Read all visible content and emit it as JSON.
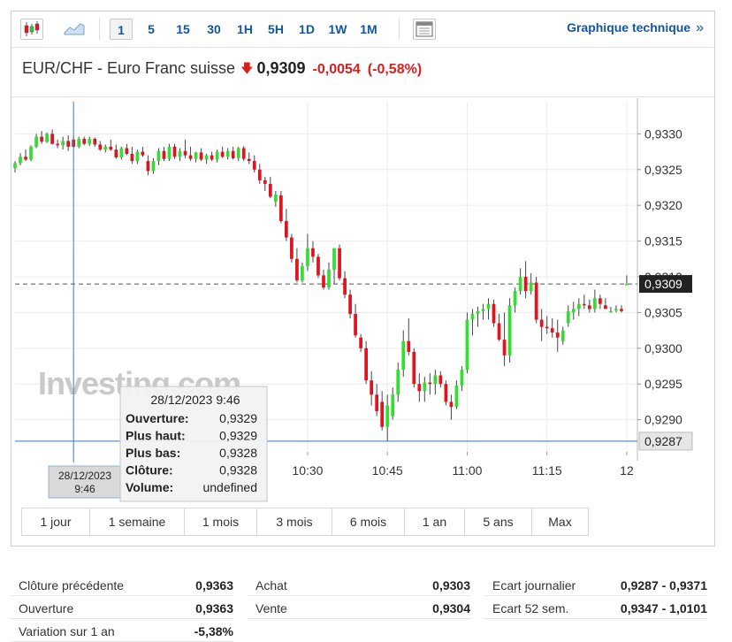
{
  "toolbar": {
    "icons": [
      "candlestick-chart-icon",
      "area-chart-icon",
      "fullscreen-chart-icon"
    ],
    "intervals": [
      "1",
      "5",
      "15",
      "30",
      "1H",
      "5H",
      "1D",
      "1W",
      "1M"
    ],
    "active_interval": "1",
    "tech_link": "Graphique technique",
    "tech_link_icon": "»"
  },
  "quote": {
    "pair": "EUR/CHF - Euro Franc suisse",
    "direction_icon": "down-arrow-icon",
    "price": "0,9309",
    "change": "-0,0054",
    "change_pct": "(-0,58%)"
  },
  "colors": {
    "up": "#33dd33",
    "down": "#e0141e",
    "negative_text": "#d91e1e",
    "link": "#1256a0",
    "crosshair": "#3a78c2"
  },
  "chart_data": {
    "type": "candlestick",
    "x_tick_labels": [
      "10:30",
      "10:45",
      "11:00",
      "11:15",
      "12"
    ],
    "x_ticks": [
      "10:30",
      "10:45",
      "11:00",
      "11:15",
      "11:30"
    ],
    "y_tick_labels": [
      "0,9330",
      "0,9325",
      "0,9320",
      "0,9315",
      "0,9310",
      "0,9305",
      "0,9300",
      "0,9295",
      "0,9290"
    ],
    "y_ticks": [
      0.933,
      0.9325,
      0.932,
      0.9315,
      0.931,
      0.9305,
      0.93,
      0.9295,
      0.929
    ],
    "ylim": [
      0.92855,
      0.93345
    ],
    "x_start": "09:35",
    "x_end": "11:32",
    "current_price": 0.9309,
    "current_price_label": "0,9309",
    "crosshair_price": 0.9287,
    "crosshair_price_label": "0,9287",
    "crosshair_time": "09:46",
    "crosshair_time_label": [
      "28/12/2023",
      "9:46"
    ],
    "watermark": "Investing.com",
    "candles": [
      [
        "09:35",
        0.93252,
        0.93262,
        0.93246,
        0.93259
      ],
      [
        "09:36",
        0.93259,
        0.93273,
        0.93256,
        0.93268
      ],
      [
        "09:37",
        0.93268,
        0.93278,
        0.93262,
        0.93264
      ],
      [
        "09:38",
        0.93264,
        0.93284,
        0.93262,
        0.93282
      ],
      [
        "09:39",
        0.93282,
        0.933,
        0.9328,
        0.93296
      ],
      [
        "09:40",
        0.93296,
        0.93304,
        0.93286,
        0.93289
      ],
      [
        "09:41",
        0.93289,
        0.93302,
        0.93287,
        0.933
      ],
      [
        "09:42",
        0.933,
        0.93306,
        0.93285,
        0.93286
      ],
      [
        "09:43",
        0.93286,
        0.93292,
        0.9328,
        0.93284
      ],
      [
        "09:44",
        0.93284,
        0.93296,
        0.93278,
        0.9329
      ],
      [
        "09:45",
        0.9329,
        0.93298,
        0.93276,
        0.93282
      ],
      [
        "09:46",
        0.93292,
        0.93296,
        0.9328,
        0.93282
      ],
      [
        "09:47",
        0.93282,
        0.93296,
        0.9328,
        0.93293
      ],
      [
        "09:48",
        0.93293,
        0.93296,
        0.93284,
        0.93286
      ],
      [
        "09:49",
        0.93286,
        0.93296,
        0.93283,
        0.93293
      ],
      [
        "09:50",
        0.93293,
        0.93295,
        0.93282,
        0.93285
      ],
      [
        "09:51",
        0.93285,
        0.9329,
        0.93276,
        0.93278
      ],
      [
        "09:52",
        0.93278,
        0.93285,
        0.93274,
        0.93282
      ],
      [
        "09:53",
        0.93282,
        0.93292,
        0.93276,
        0.93278
      ],
      [
        "09:54",
        0.93278,
        0.93285,
        0.93265,
        0.93267
      ],
      [
        "09:55",
        0.93267,
        0.93282,
        0.93264,
        0.9328
      ],
      [
        "09:56",
        0.9328,
        0.93286,
        0.9327,
        0.93272
      ],
      [
        "09:57",
        0.93272,
        0.93282,
        0.93258,
        0.93262
      ],
      [
        "09:58",
        0.93262,
        0.93278,
        0.93258,
        0.93275
      ],
      [
        "09:59",
        0.93275,
        0.93282,
        0.93268,
        0.9327
      ],
      [
        "10:00",
        0.93262,
        0.9327,
        0.93242,
        0.93248
      ],
      [
        "10:01",
        0.93248,
        0.93266,
        0.93244,
        0.93262
      ],
      [
        "10:02",
        0.93262,
        0.9328,
        0.93256,
        0.93276
      ],
      [
        "10:03",
        0.93276,
        0.93282,
        0.93262,
        0.93265
      ],
      [
        "10:04",
        0.93265,
        0.93286,
        0.93262,
        0.93282
      ],
      [
        "10:05",
        0.93282,
        0.93286,
        0.93265,
        0.93268
      ],
      [
        "10:06",
        0.93268,
        0.9328,
        0.93262,
        0.93276
      ],
      [
        "10:07",
        0.93276,
        0.93292,
        0.93266,
        0.9327
      ],
      [
        "10:08",
        0.9327,
        0.93282,
        0.93262,
        0.93265
      ],
      [
        "10:09",
        0.93265,
        0.93275,
        0.9326,
        0.93274
      ],
      [
        "10:10",
        0.93274,
        0.9328,
        0.93262,
        0.93264
      ],
      [
        "10:11",
        0.93264,
        0.93272,
        0.93258,
        0.9327
      ],
      [
        "10:12",
        0.9327,
        0.93275,
        0.93262,
        0.93264
      ],
      [
        "10:13",
        0.93264,
        0.93278,
        0.9326,
        0.93275
      ],
      [
        "10:14",
        0.93275,
        0.93282,
        0.93266,
        0.93268
      ],
      [
        "10:15",
        0.93268,
        0.9328,
        0.93264,
        0.93276
      ],
      [
        "10:16",
        0.93276,
        0.93282,
        0.93264,
        0.93266
      ],
      [
        "10:17",
        0.93266,
        0.93282,
        0.93262,
        0.9328
      ],
      [
        "10:18",
        0.9328,
        0.93283,
        0.93262,
        0.93265
      ],
      [
        "10:19",
        0.93265,
        0.93274,
        0.93258,
        0.93262
      ],
      [
        "10:20",
        0.93262,
        0.9327,
        0.93246,
        0.9325
      ],
      [
        "10:21",
        0.9325,
        0.93258,
        0.9323,
        0.93235
      ],
      [
        "10:22",
        0.93235,
        0.9324,
        0.9322,
        0.9323
      ],
      [
        "10:23",
        0.9323,
        0.9324,
        0.9321,
        0.93212
      ],
      [
        "10:24",
        0.93205,
        0.9322,
        0.93198,
        0.93215
      ],
      [
        "10:25",
        0.93214,
        0.9322,
        0.93175,
        0.93178
      ],
      [
        "10:26",
        0.93178,
        0.93195,
        0.9315,
        0.93155
      ],
      [
        "10:27",
        0.93155,
        0.9316,
        0.9312,
        0.93125
      ],
      [
        "10:28",
        0.93125,
        0.9314,
        0.93092,
        0.93095
      ],
      [
        "10:29",
        0.93095,
        0.9312,
        0.93092,
        0.93115
      ],
      [
        "10:30",
        0.93115,
        0.9316,
        0.93108,
        0.9314
      ],
      [
        "10:31",
        0.9314,
        0.9315,
        0.9312,
        0.93128
      ],
      [
        "10:32",
        0.93128,
        0.93132,
        0.93098,
        0.93102
      ],
      [
        "10:33",
        0.93102,
        0.9311,
        0.93082,
        0.93085
      ],
      [
        "10:34",
        0.93085,
        0.9312,
        0.93082,
        0.9311
      ],
      [
        "10:35",
        0.9311,
        0.9314,
        0.9309,
        0.9314
      ],
      [
        "10:36",
        0.9314,
        0.93145,
        0.93095,
        0.93098
      ],
      [
        "10:37",
        0.93098,
        0.93108,
        0.9307,
        0.93075
      ],
      [
        "10:38",
        0.93075,
        0.93082,
        0.93042,
        0.93048
      ],
      [
        "10:39",
        0.93048,
        0.93062,
        0.93015,
        0.93018
      ],
      [
        "10:40",
        0.93015,
        0.9302,
        0.92995,
        0.93
      ],
      [
        "10:41",
        0.93,
        0.9301,
        0.9295,
        0.92955
      ],
      [
        "10:42",
        0.92955,
        0.92968,
        0.9292,
        0.92935
      ],
      [
        "10:43",
        0.92935,
        0.9295,
        0.92905,
        0.92912
      ],
      [
        "10:44",
        0.92925,
        0.9294,
        0.92885,
        0.9289
      ],
      [
        "10:45",
        0.9289,
        0.92935,
        0.9287,
        0.9292
      ],
      [
        "10:46",
        0.92905,
        0.92945,
        0.929,
        0.92935
      ],
      [
        "10:47",
        0.92935,
        0.9298,
        0.92925,
        0.9297
      ],
      [
        "10:48",
        0.9297,
        0.93025,
        0.9296,
        0.9301
      ],
      [
        "10:49",
        0.9301,
        0.93042,
        0.9299,
        0.92995
      ],
      [
        "10:50",
        0.92995,
        0.93,
        0.92945,
        0.9295
      ],
      [
        "10:51",
        0.9295,
        0.92965,
        0.92925,
        0.9294
      ],
      [
        "10:52",
        0.9294,
        0.9296,
        0.92925,
        0.92952
      ],
      [
        "10:53",
        0.92952,
        0.92965,
        0.92935,
        0.9295
      ],
      [
        "10:54",
        0.9295,
        0.9297,
        0.92935,
        0.92962
      ],
      [
        "10:55",
        0.92962,
        0.92968,
        0.92945,
        0.9295
      ],
      [
        "10:56",
        0.9295,
        0.92955,
        0.9292,
        0.92925
      ],
      [
        "10:57",
        0.92925,
        0.92935,
        0.929,
        0.92918
      ],
      [
        "10:58",
        0.92918,
        0.92955,
        0.92915,
        0.92948
      ],
      [
        "10:59",
        0.92948,
        0.92975,
        0.9294,
        0.9297
      ],
      [
        "11:00",
        0.9297,
        0.9305,
        0.92965,
        0.9304
      ],
      [
        "11:01",
        0.9304,
        0.93055,
        0.93018,
        0.93048
      ],
      [
        "11:02",
        0.93048,
        0.93058,
        0.9303,
        0.93052
      ],
      [
        "11:03",
        0.93052,
        0.93062,
        0.9304,
        0.93055
      ],
      [
        "11:04",
        0.93055,
        0.9307,
        0.9304,
        0.93062
      ],
      [
        "11:05",
        0.93062,
        0.93068,
        0.9303,
        0.93035
      ],
      [
        "11:06",
        0.93035,
        0.93048,
        0.9301,
        0.93012
      ],
      [
        "11:07",
        0.93012,
        0.9305,
        0.92975,
        0.9299
      ],
      [
        "11:08",
        0.9299,
        0.9307,
        0.9298,
        0.9306
      ],
      [
        "11:09",
        0.9306,
        0.93085,
        0.9305,
        0.9308
      ],
      [
        "11:10",
        0.9308,
        0.93112,
        0.93075,
        0.931
      ],
      [
        "11:11",
        0.931,
        0.93122,
        0.9307,
        0.9308
      ],
      [
        "11:12",
        0.9308,
        0.93105,
        0.93075,
        0.93092
      ],
      [
        "11:13",
        0.93092,
        0.931,
        0.93035,
        0.9304
      ],
      [
        "11:14",
        0.9304,
        0.93055,
        0.9301,
        0.9303
      ],
      [
        "11:15",
        0.9303,
        0.93045,
        0.9302,
        0.93028
      ],
      [
        "11:16",
        0.93028,
        0.93042,
        0.93015,
        0.93022
      ],
      [
        "11:17",
        0.93022,
        0.9304,
        0.92995,
        0.93015
      ],
      [
        "11:18",
        0.9301,
        0.9303,
        0.93005,
        0.93025
      ],
      [
        "11:19",
        0.93035,
        0.9306,
        0.9303,
        0.93052
      ],
      [
        "11:20",
        0.9305,
        0.93065,
        0.9304,
        0.93055
      ],
      [
        "11:21",
        0.93055,
        0.9307,
        0.93045,
        0.93062
      ],
      [
        "11:22",
        0.93062,
        0.93075,
        0.93055,
        0.9306
      ],
      [
        "11:23",
        0.9306,
        0.93068,
        0.9305,
        0.93055
      ],
      [
        "11:24",
        0.93055,
        0.93082,
        0.9305,
        0.9307
      ],
      [
        "11:25",
        0.9307,
        0.93075,
        0.93055,
        0.93062
      ],
      [
        "11:26",
        0.9306,
        0.9307,
        0.93055,
        0.93055
      ],
      [
        "11:27",
        0.93052,
        0.93058,
        0.9305,
        0.93052
      ],
      [
        "11:28",
        0.93055,
        0.9306,
        0.9305,
        0.93055
      ],
      [
        "11:29",
        0.93055,
        0.9306,
        0.9305,
        0.93052
      ],
      [
        "11:30",
        0.9309,
        0.93102,
        0.9309,
        0.9309
      ]
    ]
  },
  "tooltip": {
    "date": "28/12/2023 9:46",
    "rows": [
      {
        "label": "Ouverture:",
        "value": "0,9329"
      },
      {
        "label": "Plus haut:",
        "value": "0,9329"
      },
      {
        "label": "Plus bas:",
        "value": "0,9328"
      },
      {
        "label": "Clôture:",
        "value": "0,9328"
      },
      {
        "label": "Volume:",
        "value": "undefined"
      }
    ]
  },
  "ranges": [
    "1 jour",
    "1 semaine",
    "1 mois",
    "3 mois",
    "6 mois",
    "1 an",
    "5 ans",
    "Max"
  ],
  "stats": {
    "col1": [
      {
        "label": "Clôture précédente",
        "value": "0,9363"
      },
      {
        "label": "Ouverture",
        "value": "0,9363"
      },
      {
        "label": "Variation sur 1 an",
        "value": "-5,38%"
      }
    ],
    "col2": [
      {
        "label": "Achat",
        "value": "0,9303"
      },
      {
        "label": "Vente",
        "value": "0,9304"
      }
    ],
    "col3": [
      {
        "label": "Ecart journalier",
        "value": "0,9287 - 0,9371"
      },
      {
        "label": "Ecart 52 sem.",
        "value": "0,9347 - 1,0101"
      }
    ]
  }
}
